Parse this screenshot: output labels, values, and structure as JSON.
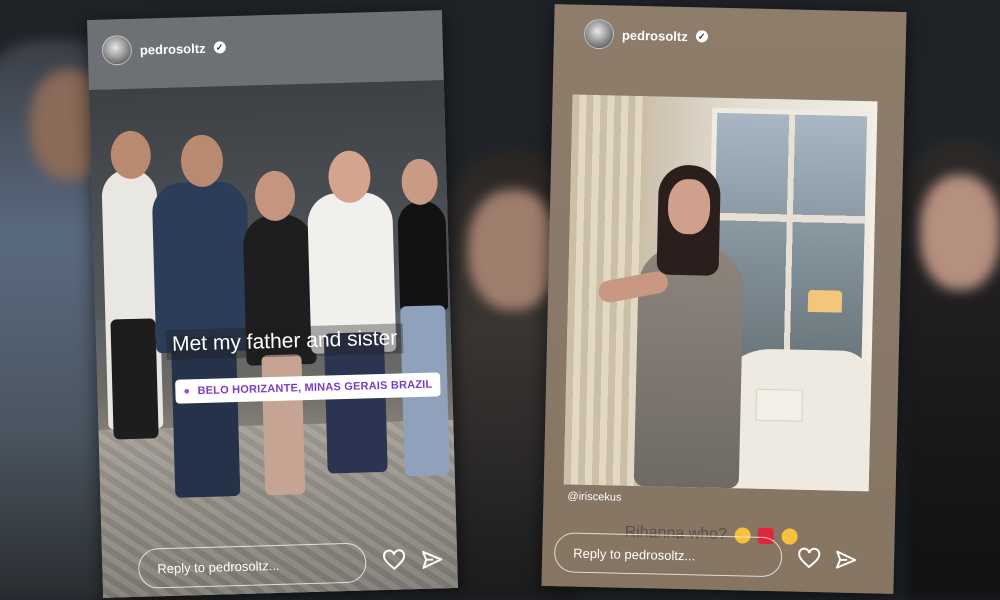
{
  "stories": [
    {
      "username": "pedrosoltz",
      "verified_mark": "✓",
      "caption": "Met my father and sister",
      "location": "BELO HORIZANTE, MINAS GERAIS BRAZIL",
      "reply_placeholder": "Reply to pedrosoltz..."
    },
    {
      "username": "pedrosoltz",
      "verified_mark": "✓",
      "mention": "@iriscekus",
      "caption": "Rihanna who?",
      "reply_placeholder": "Reply to pedrosoltz..."
    }
  ],
  "icons": {
    "like": "heart-icon",
    "send": "send-icon",
    "location": "location-pin-icon"
  },
  "colors": {
    "location_text": "#7a3cc4",
    "background": "#1f2328"
  }
}
